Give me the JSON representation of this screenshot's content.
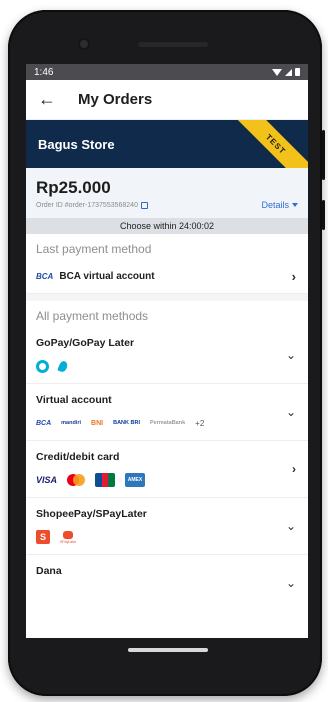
{
  "status_bar": {
    "time": "1:46"
  },
  "app_bar": {
    "back_icon": "←",
    "title": "My Orders"
  },
  "store": {
    "name": "Bagus Store",
    "ribbon": "TEST"
  },
  "order": {
    "amount": "Rp25.000",
    "order_id": "Order ID #order-1737553568240",
    "details_label": "Details",
    "countdown": "Choose within 24:00:02"
  },
  "last_payment": {
    "heading": "Last payment method",
    "bank_logo": "BCA",
    "label": "BCA virtual account",
    "chevron": "›"
  },
  "all_payment_heading": "All payment methods",
  "methods": {
    "gopay": {
      "title": "GoPay/GoPay Later",
      "toggle": "⌄"
    },
    "virtual_account": {
      "title": "Virtual account",
      "banks": [
        "BCA",
        "mandiri",
        "BNI",
        "BANK BRI",
        "PermataBank"
      ],
      "more": "+2",
      "toggle": "⌄"
    },
    "card": {
      "title": "Credit/debit card",
      "brands": [
        "VISA",
        "mastercard",
        "JCB",
        "AMERICAN EXPRESS"
      ],
      "amex_text": "AMEX",
      "chevron": "›"
    },
    "shopeepay": {
      "title": "ShopeePay/SPayLater",
      "shopee_mark": "S",
      "spaylater_text": "SPayLater",
      "toggle": "⌄"
    },
    "dana": {
      "title": "Dana",
      "toggle": "⌄"
    }
  },
  "colors": {
    "store_banner": "#102a4c",
    "ribbon": "#f2c21a",
    "link": "#2f6fd6",
    "gopay": "#00aed6",
    "shopee": "#ee4d2d"
  },
  "icons": {
    "back": "arrow-left-icon",
    "chevron_right": "chevron-right-icon",
    "chevron_down": "chevron-down-icon",
    "copy": "copy-icon"
  }
}
